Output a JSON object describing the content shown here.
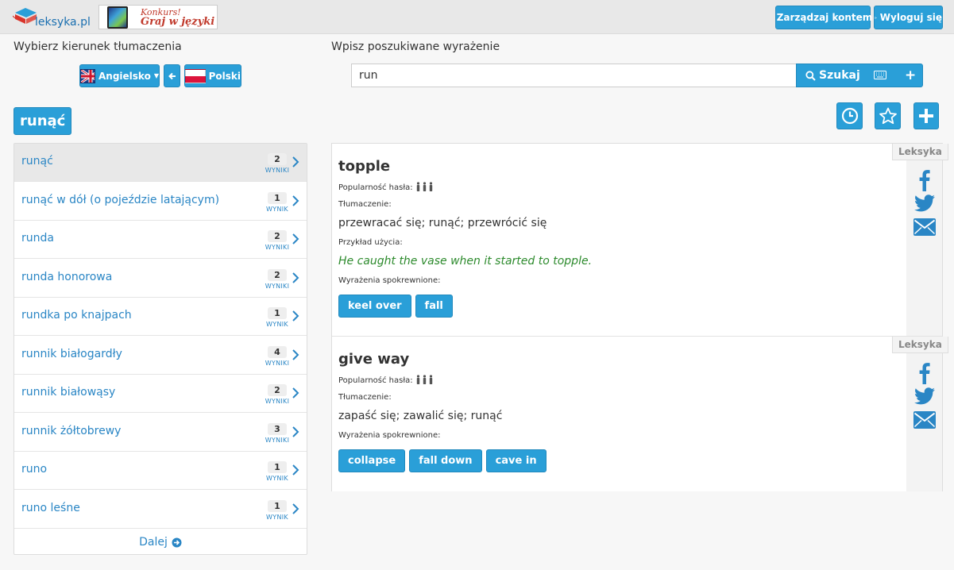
{
  "header": {
    "logo_text": "leksyka.pl",
    "promo_line1": "Konkurs!",
    "promo_line2": "Graj w języki",
    "manage_account_label": "Zarządzaj kontem",
    "logout_label": "Wyloguj się"
  },
  "direction": {
    "label": "Wybierz kierunek tłumaczenia",
    "source_lang": "Angielsko",
    "target_lang": "Polski"
  },
  "search": {
    "label": "Wpisz poszukiwane wyrażenie",
    "value": "run",
    "button_label": "Szukaj"
  },
  "current_word": "runąć",
  "list": {
    "items": [
      {
        "word": "runąć",
        "count": "2",
        "unit": "WYNIKI",
        "active": true
      },
      {
        "word": "runąć w dół (o pojeździe latającym)",
        "count": "1",
        "unit": "WYNIK"
      },
      {
        "word": "runda",
        "count": "2",
        "unit": "WYNIKI"
      },
      {
        "word": "runda honorowa",
        "count": "2",
        "unit": "WYNIKI"
      },
      {
        "word": "rundka po knajpach",
        "count": "1",
        "unit": "WYNIK"
      },
      {
        "word": "runnik białogardły",
        "count": "4",
        "unit": "WYNIKI"
      },
      {
        "word": "runnik białowąsy",
        "count": "2",
        "unit": "WYNIKI"
      },
      {
        "word": "runnik żółtobrewy",
        "count": "3",
        "unit": "WYNIKI"
      },
      {
        "word": "runo",
        "count": "1",
        "unit": "WYNIK"
      },
      {
        "word": "runo leśne",
        "count": "1",
        "unit": "WYNIK"
      }
    ],
    "more_label": "Dalej"
  },
  "entries": [
    {
      "title": "topple",
      "source": "Leksyka",
      "popularity_label": "Popularność hasła:",
      "popularity": 3,
      "translation_label": "Tłumaczenie:",
      "translation": "przewracać się; runąć; przewrócić się",
      "example_label": "Przykład użycia:",
      "example": "He caught the vase when it started to topple.",
      "related_label": "Wyrażenia spokrewnione:",
      "related": [
        "keel over",
        "fall"
      ]
    },
    {
      "title": "give way",
      "source": "Leksyka",
      "popularity_label": "Popularność hasła:",
      "popularity": 3,
      "translation_label": "Tłumaczenie:",
      "translation": "zapaść się; zawalić się; runąć",
      "related_label": "Wyrażenia spokrewnione:",
      "related": [
        "collapse",
        "fall down",
        "cave in"
      ]
    }
  ],
  "colors": {
    "accent": "#2a9fd8",
    "link": "#2a86c5",
    "example_text": "#2c8a2c",
    "facebook": "#3b5998"
  }
}
